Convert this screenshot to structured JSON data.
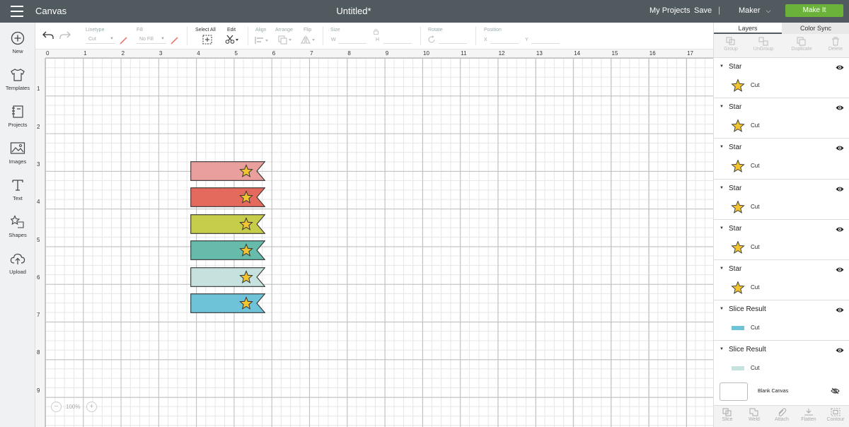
{
  "topbar": {
    "app_title": "Canvas",
    "doc_title": "Untitled*",
    "my_projects": "My Projects",
    "save": "Save",
    "separator": "|",
    "machine": "Maker",
    "make_it": "Make It",
    "make_it_color": "#6bb23a",
    "bg_color": "#505a5f"
  },
  "sidebar": {
    "items": [
      {
        "label": "New",
        "icon": "plus-circle-icon"
      },
      {
        "label": "Templates",
        "icon": "shirt-icon"
      },
      {
        "label": "Projects",
        "icon": "notebook-icon"
      },
      {
        "label": "Images",
        "icon": "image-icon"
      },
      {
        "label": "Text",
        "icon": "text-t-icon"
      },
      {
        "label": "Shapes",
        "icon": "shapes-icon"
      },
      {
        "label": "Upload",
        "icon": "cloud-upload-icon"
      }
    ]
  },
  "toolbar": {
    "linetype_label": "Linetype",
    "linetype_value": "Cut",
    "fill_label": "Fill",
    "fill_value": "No Fill",
    "select_all": "Select All",
    "edit": "Edit",
    "align": "Align",
    "arrange": "Arrange",
    "flip": "Flip",
    "size": "Size",
    "w": "W",
    "h": "H",
    "rotate": "Rotate",
    "position": "Position",
    "x": "X",
    "y": "Y"
  },
  "canvas": {
    "ruler_x": [
      "0",
      "1",
      "2",
      "3",
      "4",
      "5",
      "6",
      "7",
      "8",
      "9",
      "10",
      "11",
      "12",
      "13",
      "14",
      "15",
      "16",
      "17"
    ],
    "ruler_y": [
      "1",
      "2",
      "3",
      "4",
      "5",
      "6",
      "7",
      "8",
      "9"
    ],
    "zoom": "100%",
    "flag_colors": [
      "#e9a09c",
      "#e46a5e",
      "#c6cd4b",
      "#66bbab",
      "#c6e2de",
      "#6fc3d8"
    ],
    "star_color": "#f2c530"
  },
  "panel": {
    "tabs": [
      "Layers",
      "Color Sync"
    ],
    "actions": [
      "Group",
      "UnGroup",
      "Duplicate",
      "Delete"
    ],
    "layers": [
      {
        "name": "Star",
        "op": "Cut",
        "kind": "star"
      },
      {
        "name": "Star",
        "op": "Cut",
        "kind": "star"
      },
      {
        "name": "Star",
        "op": "Cut",
        "kind": "star"
      },
      {
        "name": "Star",
        "op": "Cut",
        "kind": "star"
      },
      {
        "name": "Star",
        "op": "Cut",
        "kind": "star"
      },
      {
        "name": "Star",
        "op": "Cut",
        "kind": "star"
      },
      {
        "name": "Slice Result",
        "op": "Cut",
        "kind": "rect",
        "color": "#6fc3d8"
      },
      {
        "name": "Slice Result",
        "op": "Cut",
        "kind": "rect",
        "color": "#c6e2de"
      }
    ],
    "blank_canvas": "Blank Canvas",
    "bottom_actions": [
      "Slice",
      "Weld",
      "Attach",
      "Flatten",
      "Contour"
    ]
  }
}
